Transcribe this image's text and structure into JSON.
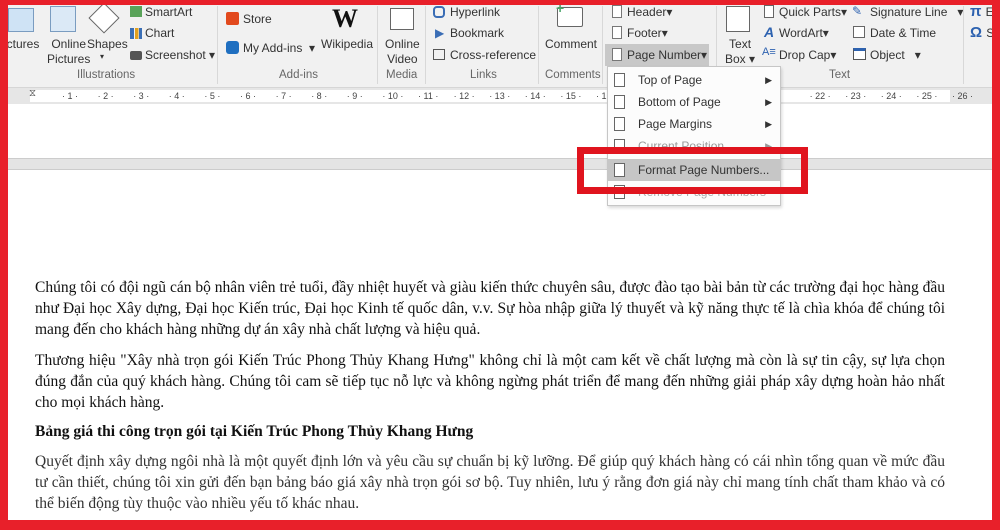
{
  "ribbon": {
    "illustrations": {
      "pictures": "ictures",
      "online_pictures_1": "Online",
      "online_pictures_2": "Pictures",
      "shapes": "Shapes",
      "smartart": "SmartArt",
      "chart": "Chart",
      "screenshot": "Screenshot",
      "label": "Illustrations"
    },
    "addins": {
      "store": "Store",
      "my_addins": "My Add-ins",
      "wikipedia": "Wikipedia",
      "label": "Add-ins"
    },
    "media": {
      "online_video_1": "Online",
      "online_video_2": "Video",
      "label": "Media"
    },
    "links": {
      "hyperlink": "Hyperlink",
      "bookmark": "Bookmark",
      "cross_reference": "Cross-reference",
      "label": "Links"
    },
    "comments": {
      "comment": "Comment",
      "label": "Comments"
    },
    "header_footer": {
      "header": "Header",
      "footer": "Footer",
      "page_number": "Page Number"
    },
    "text": {
      "text_box_1": "Text",
      "text_box_2": "Box",
      "quick_parts": "Quick Parts",
      "wordart": "WordArt",
      "drop_cap": "Drop Cap",
      "signature_line": "Signature Line",
      "date_time": "Date & Time",
      "object": "Object",
      "label": "Text"
    },
    "symbols": {
      "equation": "E",
      "symbol": "S"
    }
  },
  "ruler": {
    "ticks": [
      "1",
      "2",
      "3",
      "4",
      "5",
      "6",
      "7",
      "8",
      "9",
      "10",
      "11",
      "12",
      "13",
      "14",
      "15",
      "16",
      "22",
      "23",
      "24",
      "25",
      "26"
    ]
  },
  "menu": {
    "items": [
      "Top of Page",
      "Bottom of Page",
      "Page Margins",
      "Current Position",
      "Format Page Numbers...",
      "Remove Page Numbers"
    ]
  },
  "document": {
    "p1": "Chúng tôi có đội ngũ cán bộ nhân viên trẻ tuổi, đầy nhiệt huyết và giàu kiến thức chuyên sâu, được đào tạo bài bản từ các trường đại học hàng đầu như Đại học Xây dựng, Đại học Kiến trúc, Đại học Kinh tế quốc dân, v.v. Sự hòa nhập giữa lý thuyết và kỹ năng thực tế là chìa khóa để chúng tôi mang đến cho khách hàng những dự án xây nhà chất lượng và hiệu quả.",
    "p2": "Thương hiệu \"Xây nhà trọn gói Kiến Trúc Phong Thủy Khang Hưng\" không chỉ là một cam kết về chất lượng mà còn là sự tin cậy, sự lựa chọn đúng đắn của quý khách hàng. Chúng tôi cam sẽ tiếp tục nỗ lực và không ngừng phát triển để mang đến những giải pháp xây dựng hoàn hảo nhất cho mọi khách hàng.",
    "heading": "Bảng giá thi công trọn gói tại Kiến Trúc Phong Thủy Khang Hưng",
    "p3": "Quyết định xây dựng ngôi nhà là một quyết định lớn và yêu cầu sự chuẩn bị kỹ lưỡng. Để giúp quý khách hàng có cái nhìn tổng quan về mức đầu tư cần thiết, chúng tôi xin gửi đến bạn bảng báo giá xây nhà trọn gói sơ bộ. Tuy nhiên, lưu ý rằng đơn giá này chỉ mang tính chất tham khảo và có thể biến động tùy thuộc vào nhiều yếu tố khác nhau."
  },
  "colors": {
    "highlight_frame": "#e0141e",
    "ribbon_bg": "#f1f1f1"
  }
}
